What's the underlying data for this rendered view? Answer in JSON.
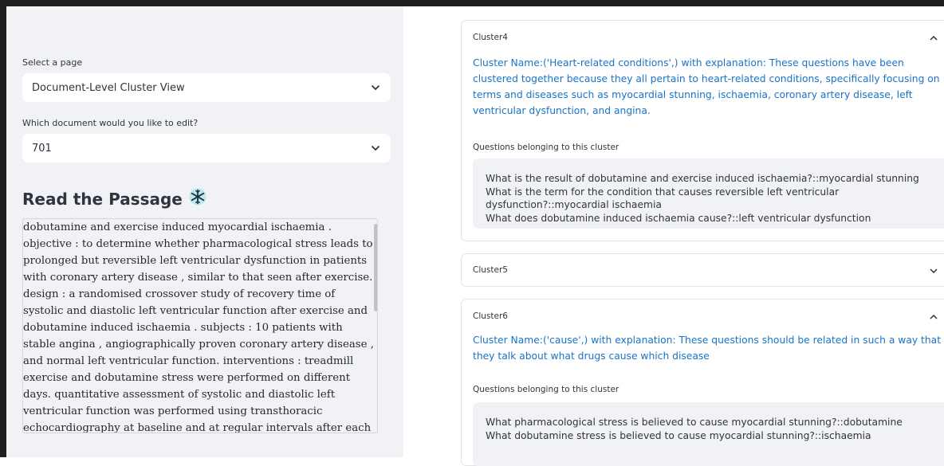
{
  "sidebar": {
    "page_select_label": "Select a page",
    "page_select_value": "Document-Level Cluster View",
    "doc_select_label": "Which document would you like to edit?",
    "doc_select_value": "701",
    "passage_heading": "Read the Passage",
    "passage_icon": "snowflake-icon",
    "passage_text": "dobutamine and exercise induced myocardial ischaemia . objective : to determine whether pharmacological stress leads to prolonged but reversible left ventricular dysfunction in patients with coronary artery disease , similar to that seen after exercise. design : a randomised crossover study of recovery time of systolic and diastolic left ventricular function after exercise and dobutamine induced ischaemia . subjects : 10 patients with stable angina , angiographically proven coronary artery disease , and normal left ventricular function. interventions : treadmill exercise and dobutamine stress were performed on different days. quantitative assessment of systolic and diastolic left ventricular function was performed using transthoracic echocardiography at baseline and at regular intervals after each test."
  },
  "clusters": [
    {
      "label": "Cluster4",
      "expanded": true,
      "toggle_icon": "chevron-up-icon",
      "name": "Cluster Name:('Heart-related conditions',) with explanation: These questions have been clustered together because they all pertain to heart-related conditions, specifically focusing on terms and diseases such as myocardial stunning, ischaemia, coronary artery disease, left ventricular dysfunction, and angina.",
      "questions_label": "Questions belonging to this cluster",
      "questions": [
        "What is the result of dobutamine and exercise induced ischaemia?::myocardial stunning",
        "What is the term for the condition that causes reversible left ventricular dysfunction?::myocardial ischaemia",
        "What does dobutamine induced ischaemia cause?::left ventricular dysfunction"
      ]
    },
    {
      "label": "Cluster5",
      "expanded": false,
      "toggle_icon": "chevron-down-icon"
    },
    {
      "label": "Cluster6",
      "expanded": true,
      "toggle_icon": "chevron-up-icon",
      "name": "Cluster Name:('cause',) with explanation: These questions should be related in such a way that they talk about what drugs cause which disease",
      "questions_label": "Questions belonging to this cluster",
      "questions": [
        "What pharmacological stress is believed to cause myocardial stunning?::dobutamine",
        "What dobutamine stress is believed to cause myocardial stunning?::ischaemia"
      ]
    }
  ],
  "colors": {
    "sidebar_bg": "#f0f2f6",
    "link_blue": "#1a73c7",
    "text": "#31333f"
  }
}
